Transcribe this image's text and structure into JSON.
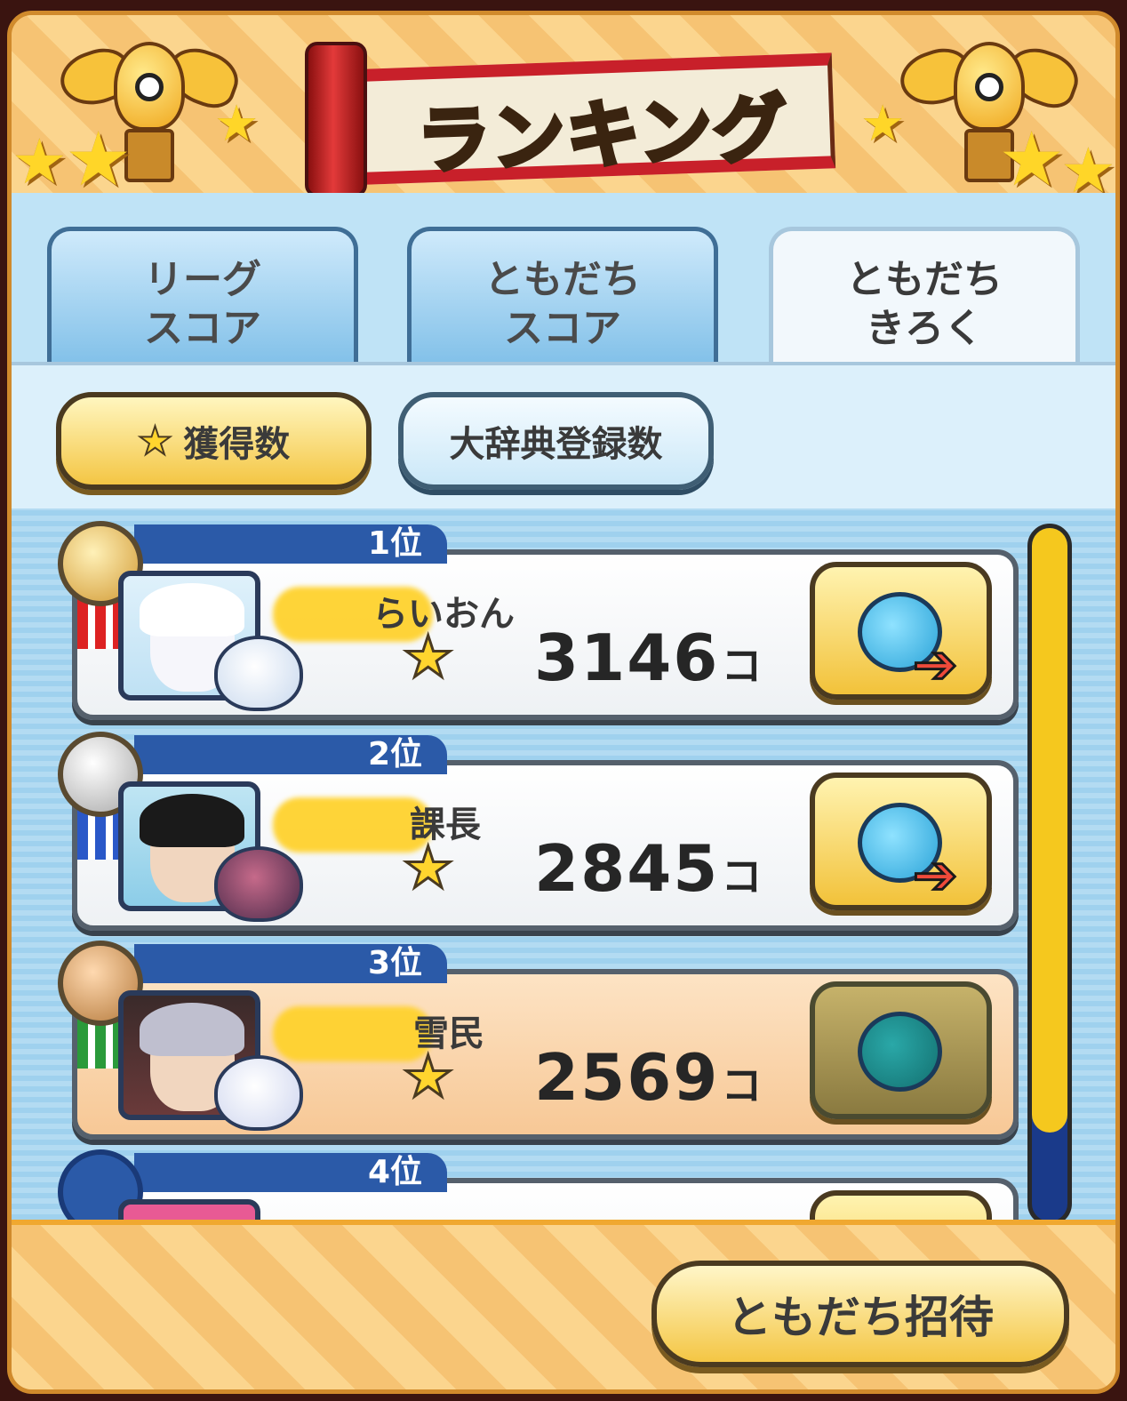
{
  "header": {
    "title": "ランキング"
  },
  "tabs": [
    {
      "label": "リーグ\nスコア",
      "active": false
    },
    {
      "label": "ともだち\nスコア",
      "active": false
    },
    {
      "label": "ともだち\nきろく",
      "active": true
    }
  ],
  "filters": {
    "stars_label": "獲得数",
    "encyclopedia_label": "大辞典登録数",
    "selected": "獲得数"
  },
  "rankings": [
    {
      "rank": "1位",
      "name": "らいおん",
      "score": "3146",
      "unit": "コ",
      "medal": "gold",
      "send_enabled": true
    },
    {
      "rank": "2位",
      "name": "課長",
      "score": "2845",
      "unit": "コ",
      "medal": "silver",
      "send_enabled": true
    },
    {
      "rank": "3位",
      "name": "雪民",
      "score": "2569",
      "unit": "コ",
      "medal": "bronze",
      "send_enabled": false,
      "highlighted": true
    },
    {
      "rank": "4位",
      "name": "",
      "score": "",
      "unit": "",
      "medal": "none",
      "send_enabled": true
    }
  ],
  "footer": {
    "invite_label": "ともだち招待"
  },
  "colors": {
    "accent_gold": "#f4c644",
    "panel_blue": "#2b5aa8",
    "scroll_red": "#c8202a"
  },
  "icons": {
    "star": "star-icon",
    "send": "soul-send-icon",
    "trophy": "trophy-icon"
  }
}
